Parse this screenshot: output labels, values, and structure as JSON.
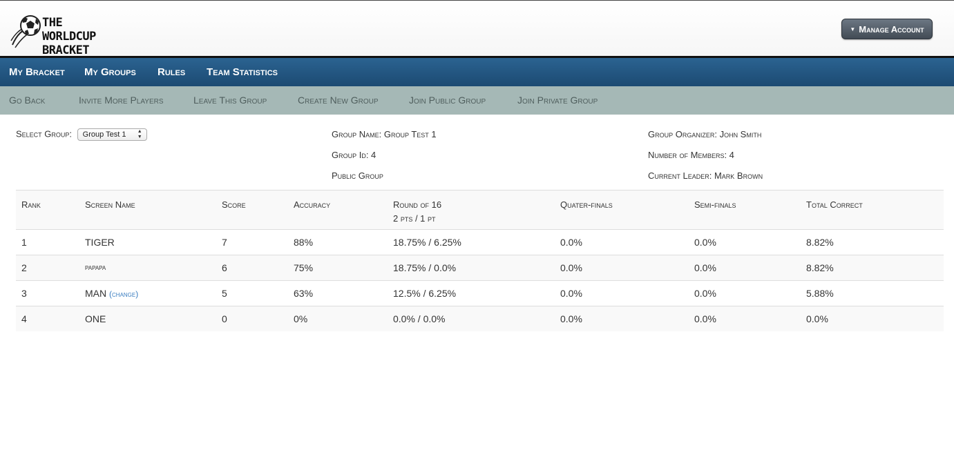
{
  "header": {
    "logo_line1": "THE",
    "logo_line2": "WORLDCUP BRACKET",
    "manage_account": "Manage Account"
  },
  "mainnav": [
    "My Bracket",
    "My Groups",
    "Rules",
    "Team Statistics"
  ],
  "subnav": [
    "Go Back",
    "Invite More Players",
    "Leave This Group",
    "Create New Group",
    "Join Public Group",
    "Join Private Group"
  ],
  "group": {
    "select_label": "Select Group:",
    "select_value": "Group Test 1",
    "name": "Group Name: Group Test 1",
    "id": "Group Id: 4",
    "visibility": "Public Group",
    "organizer": "Group Organizer: John Smith",
    "members": "Number of Members: 4",
    "leader": "Current Leader: Mark Brown"
  },
  "table": {
    "headers": {
      "rank": "Rank",
      "screen_name": "Screen Name",
      "score": "Score",
      "accuracy": "Accuracy",
      "round16": "Round of 16",
      "round16_sub": "2 pts / 1 pt",
      "quarter": "Quater-finals",
      "semi": "Semi-finals",
      "total": "Total Correct"
    },
    "rows": [
      {
        "rank": "1",
        "name": "TIGER",
        "score": "7",
        "accuracy": "88%",
        "r16": "18.75% / 6.25%",
        "qf": "0.0%",
        "sf": "0.0%",
        "total": "8.82%"
      },
      {
        "rank": "2",
        "name": "papapa",
        "score": "6",
        "accuracy": "75%",
        "r16": "18.75% / 0.0%",
        "qf": "0.0%",
        "sf": "0.0%",
        "total": "8.82%"
      },
      {
        "rank": "3",
        "name": "MAN",
        "change": "(change)",
        "score": "5",
        "accuracy": "63%",
        "r16": "12.5% / 6.25%",
        "qf": "0.0%",
        "sf": "0.0%",
        "total": "5.88%"
      },
      {
        "rank": "4",
        "name": "ONE",
        "score": "0",
        "accuracy": "0%",
        "r16": "0.0% / 0.0%",
        "qf": "0.0%",
        "sf": "0.0%",
        "total": "0.0%"
      }
    ]
  }
}
